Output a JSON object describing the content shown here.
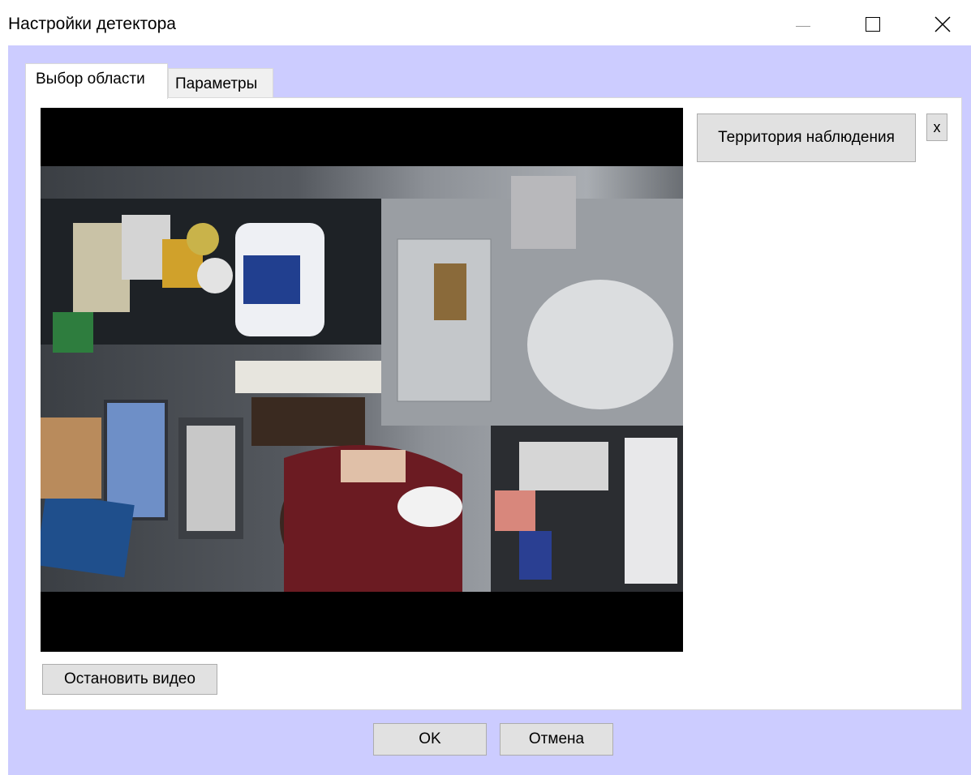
{
  "window": {
    "title": "Настройки детектора"
  },
  "tabs": [
    {
      "label": "Выбор области",
      "active": true
    },
    {
      "label": "Параметры",
      "active": false
    }
  ],
  "area_panel": {
    "zone_button_label": "Территория наблюдения",
    "remove_zone_label": "x",
    "stop_video_label": "Остановить видео"
  },
  "footer": {
    "ok_label": "OK",
    "cancel_label": "Отмена"
  },
  "colors": {
    "client_background": "#ccccff",
    "button_face": "#e1e1e1",
    "video_background": "#000000"
  },
  "icons": {
    "minimize": "minimize-icon",
    "maximize": "maximize-icon",
    "close": "close-icon"
  }
}
